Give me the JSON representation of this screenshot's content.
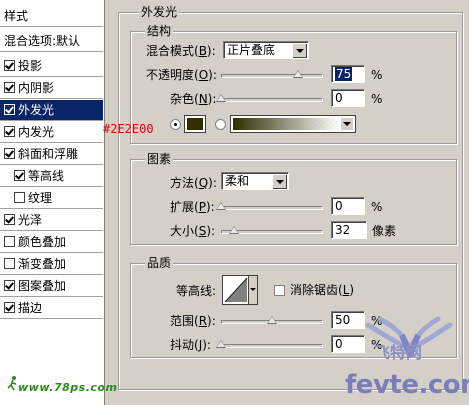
{
  "styles_panel": {
    "header": "样式",
    "blend_options": "混合选项:默认",
    "items": [
      {
        "label": "投影",
        "checked": true,
        "indent": false,
        "selected": false
      },
      {
        "label": "内阴影",
        "checked": true,
        "indent": false,
        "selected": false
      },
      {
        "label": "外发光",
        "checked": true,
        "indent": false,
        "selected": true
      },
      {
        "label": "内发光",
        "checked": true,
        "indent": false,
        "selected": false
      },
      {
        "label": "斜面和浮雕",
        "checked": true,
        "indent": false,
        "selected": false
      },
      {
        "label": "等高线",
        "checked": true,
        "indent": true,
        "selected": false
      },
      {
        "label": "纹理",
        "checked": false,
        "indent": true,
        "selected": false
      },
      {
        "label": "光泽",
        "checked": true,
        "indent": false,
        "selected": false
      },
      {
        "label": "颜色叠加",
        "checked": false,
        "indent": false,
        "selected": false
      },
      {
        "label": "渐变叠加",
        "checked": false,
        "indent": false,
        "selected": false
      },
      {
        "label": "图案叠加",
        "checked": true,
        "indent": false,
        "selected": false
      },
      {
        "label": "描边",
        "checked": true,
        "indent": false,
        "selected": false
      }
    ],
    "watermark": "www.78ps.com"
  },
  "outer_glow": {
    "title": "外发光",
    "structure": {
      "title": "结构",
      "blend_mode_label": "混合模式(",
      "blend_mode_key": "B",
      "blend_mode_value": "正片叠底",
      "opacity_label": "不透明度(",
      "opacity_key": "O",
      "opacity_value": "75",
      "opacity_level": 0.75,
      "opacity_unit": "%",
      "noise_label": "杂色(",
      "noise_key": "N",
      "noise_value": "0",
      "noise_level": 0,
      "noise_unit": "%",
      "glow_color": "#2E2E00"
    },
    "elements": {
      "title": "图素",
      "technique_label": "方法(",
      "technique_key": "Q",
      "technique_value": "柔和",
      "spread_label": "扩展(",
      "spread_key": "P",
      "spread_value": "0",
      "spread_level": 0,
      "spread_unit": "%",
      "size_label": "大小(",
      "size_key": "S",
      "size_value": "32",
      "size_level": 0.128,
      "size_unit": "像素"
    },
    "quality": {
      "title": "品质",
      "contour_label": "等高线:",
      "anti_alias_label": "消除锯齿(",
      "anti_alias_key": "L",
      "anti_alias_checked": false,
      "range_label": "范围(",
      "range_key": "R",
      "range_value": "50",
      "range_level": 0.5,
      "range_unit": "%",
      "jitter_label": "抖动(",
      "jitter_key": "J",
      "jitter_value": "0",
      "jitter_level": 0,
      "jitter_unit": "%"
    }
  },
  "annotation": {
    "color_code": "#2E2E00",
    "color": "#e00000"
  },
  "watermarks": {
    "fevte_cn": "飞特网",
    "fevte_en": "fevte.com"
  }
}
